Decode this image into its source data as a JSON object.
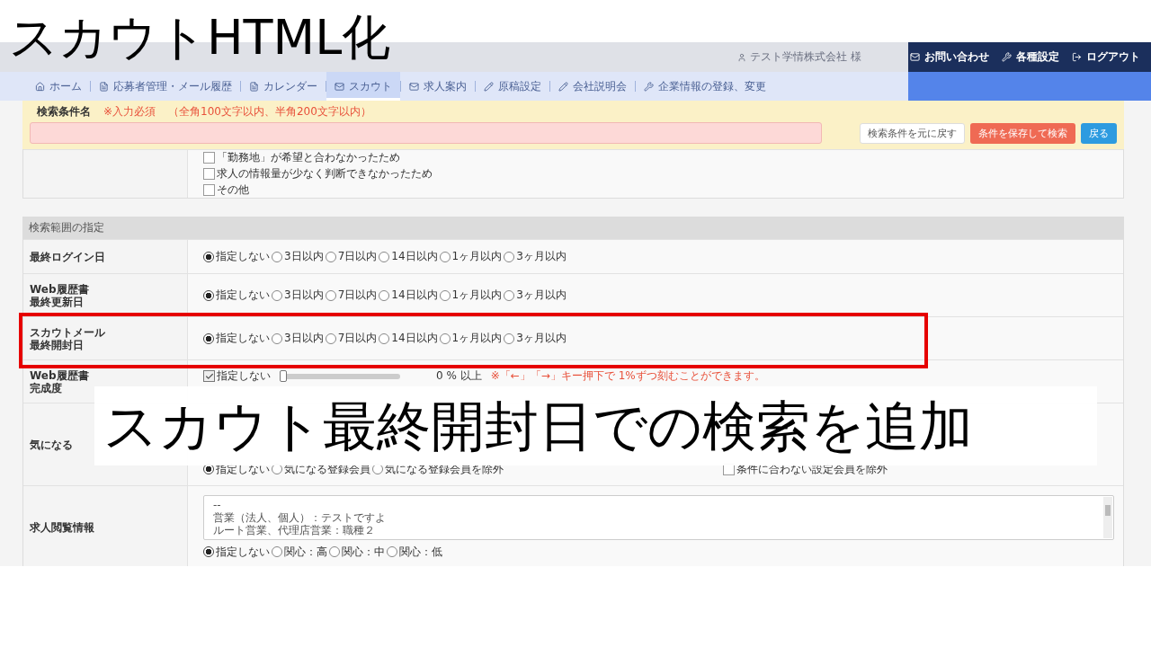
{
  "slide_title": "スカウトHTML化",
  "caption": "スカウト最終開封日での検索を追加",
  "header": {
    "user": "テスト学情株式会社 様",
    "links": [
      {
        "label": "お問い合わせ",
        "kind": "mail"
      },
      {
        "label": "各種設定",
        "kind": "wrench"
      },
      {
        "label": "ログアウト",
        "kind": "logout"
      }
    ]
  },
  "nav": [
    {
      "label": "ホーム",
      "kind": "home",
      "selected": false
    },
    {
      "label": "応募者管理・メール履歴",
      "kind": "doc",
      "selected": false
    },
    {
      "label": "カレンダー",
      "kind": "doc",
      "selected": false
    },
    {
      "label": "スカウト",
      "kind": "mail",
      "selected": true
    },
    {
      "label": "求人案内",
      "kind": "mail",
      "selected": false
    },
    {
      "label": "原稿設定",
      "kind": "pencil",
      "selected": false
    },
    {
      "label": "会社説明会",
      "kind": "pencil",
      "selected": false
    },
    {
      "label": "企業情報の登録、変更",
      "kind": "wrench",
      "selected": false
    }
  ],
  "condition": {
    "label": "検索条件名",
    "required": "※入力必須",
    "hint": "（全角100文字以内、半角200文字以内）",
    "buttons": [
      {
        "label": "検索条件を元に戻す",
        "kind": "default"
      },
      {
        "label": "条件を保存して検索",
        "kind": "danger"
      },
      {
        "label": "戻る",
        "kind": "primary"
      }
    ]
  },
  "reasons": [
    {
      "label": "「勤務地」が希望と合わなかったため",
      "checked": false
    },
    {
      "label": "求人の情報量が少なく判断できなかったため",
      "checked": false
    },
    {
      "label": "その他",
      "checked": false
    }
  ],
  "section_title": "検索範囲の指定",
  "rows": [
    {
      "kind": "radio",
      "label": [
        "最終ログイン日"
      ],
      "highlighted": false,
      "options": [
        {
          "label": "指定しない",
          "selected": true
        },
        {
          "label": "3日以内",
          "selected": false
        },
        {
          "label": "7日以内",
          "selected": false
        },
        {
          "label": "14日以内",
          "selected": false
        },
        {
          "label": "1ヶ月以内",
          "selected": false
        },
        {
          "label": "3ヶ月以内",
          "selected": false
        }
      ]
    },
    {
      "kind": "radio",
      "label": [
        "Web履歴書",
        "最終更新日"
      ],
      "highlighted": false,
      "options": [
        {
          "label": "指定しない",
          "selected": true
        },
        {
          "label": "3日以内",
          "selected": false
        },
        {
          "label": "7日以内",
          "selected": false
        },
        {
          "label": "14日以内",
          "selected": false
        },
        {
          "label": "1ヶ月以内",
          "selected": false
        },
        {
          "label": "3ヶ月以内",
          "selected": false
        }
      ]
    },
    {
      "kind": "radio",
      "label": [
        "スカウトメール",
        "最終開封日"
      ],
      "highlighted": true,
      "options": [
        {
          "label": "指定しない",
          "selected": true
        },
        {
          "label": "3日以内",
          "selected": false
        },
        {
          "label": "7日以内",
          "selected": false
        },
        {
          "label": "14日以内",
          "selected": false
        },
        {
          "label": "1ヶ月以内",
          "selected": false
        },
        {
          "label": "3ヶ月以内",
          "selected": false
        }
      ]
    },
    {
      "kind": "slider",
      "label": [
        "Web履歴書",
        "完成度"
      ],
      "highlighted": false,
      "check": {
        "label": "指定しない",
        "checked": true
      },
      "level": 0,
      "reading": "0 % 以上",
      "note": "※「←」「→」キー押下で 1%ずつ刻むことができます。"
    },
    {
      "kind": "interest",
      "label": [
        "気になる"
      ],
      "highlighted": false,
      "lines": [],
      "options": [
        {
          "label": "指定しない",
          "selected": true
        },
        {
          "label": "気になる登録会員",
          "selected": false
        },
        {
          "label": "気になる登録会員を除外",
          "selected": false
        }
      ],
      "extra": {
        "label": "条件に合わない設定会員を除外",
        "checked": false
      }
    },
    {
      "kind": "interest",
      "label": [
        "求人閲覧情報"
      ],
      "highlighted": false,
      "lines": [
        "--",
        "営業（法人、個人）：テストですよ",
        "ルート営業、代理店営業：職種２"
      ],
      "options": [
        {
          "label": "指定しない",
          "selected": true
        },
        {
          "label": "関心：高",
          "selected": false
        },
        {
          "label": "関心：中",
          "selected": false
        },
        {
          "label": "関心：低",
          "selected": false
        }
      ]
    }
  ]
}
